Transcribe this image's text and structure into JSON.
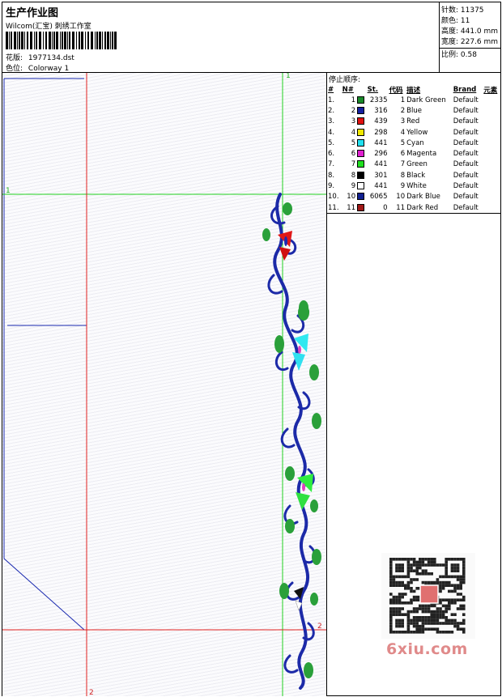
{
  "header": {
    "title": "生产作业图",
    "company": "Wilcom(汇宝) 刺绣工作室",
    "pattern_label": "花版:",
    "pattern_value": "1977134.dst",
    "colorway_label": "色位:",
    "colorway_value": "Colorway 1"
  },
  "stats": {
    "stitches": "针数: 11375",
    "colors": "颜色: 11",
    "height": "高度: 441.0 mm",
    "width": "宽度: 227.6 mm",
    "scale": "比例: 0.58"
  },
  "stop_sequence": {
    "title": "停止顺序:",
    "headers": [
      "#",
      "N#",
      "St.",
      "代码",
      "描述",
      "Brand",
      "元素"
    ],
    "rows": [
      {
        "idx": "1.",
        "n": "1",
        "color": "#1a8a2a",
        "st": "2335",
        "code": "1",
        "desc": "Dark Green",
        "brand": "Default"
      },
      {
        "idx": "2.",
        "n": "2",
        "color": "#1520a0",
        "st": "316",
        "code": "2",
        "desc": "Blue",
        "brand": "Default"
      },
      {
        "idx": "3.",
        "n": "3",
        "color": "#e01010",
        "st": "439",
        "code": "3",
        "desc": "Red",
        "brand": "Default"
      },
      {
        "idx": "4.",
        "n": "4",
        "color": "#f0e800",
        "st": "298",
        "code": "4",
        "desc": "Yellow",
        "brand": "Default"
      },
      {
        "idx": "5.",
        "n": "5",
        "color": "#20e0f0",
        "st": "441",
        "code": "5",
        "desc": "Cyan",
        "brand": "Default"
      },
      {
        "idx": "6.",
        "n": "6",
        "color": "#e020d0",
        "st": "296",
        "code": "6",
        "desc": "Magenta",
        "brand": "Default"
      },
      {
        "idx": "7.",
        "n": "7",
        "color": "#20e020",
        "st": "441",
        "code": "7",
        "desc": "Green",
        "brand": "Default"
      },
      {
        "idx": "8.",
        "n": "8",
        "color": "#000000",
        "st": "301",
        "code": "8",
        "desc": "Black",
        "brand": "Default"
      },
      {
        "idx": "9.",
        "n": "9",
        "color": "#ffffff",
        "st": "441",
        "code": "9",
        "desc": "White",
        "brand": "Default"
      },
      {
        "idx": "10.",
        "n": "10",
        "color": "#102090",
        "st": "6065",
        "code": "10",
        "desc": "Dark Blue",
        "brand": "Default"
      },
      {
        "idx": "11.",
        "n": "11",
        "color": "#a01818",
        "st": "0",
        "code": "11",
        "desc": "Dark Red",
        "brand": "Default"
      }
    ]
  },
  "guides": {
    "green_v": "1",
    "green_h": "1",
    "red_v": "2",
    "red_h": "2"
  },
  "watermark": "6xiu.com"
}
